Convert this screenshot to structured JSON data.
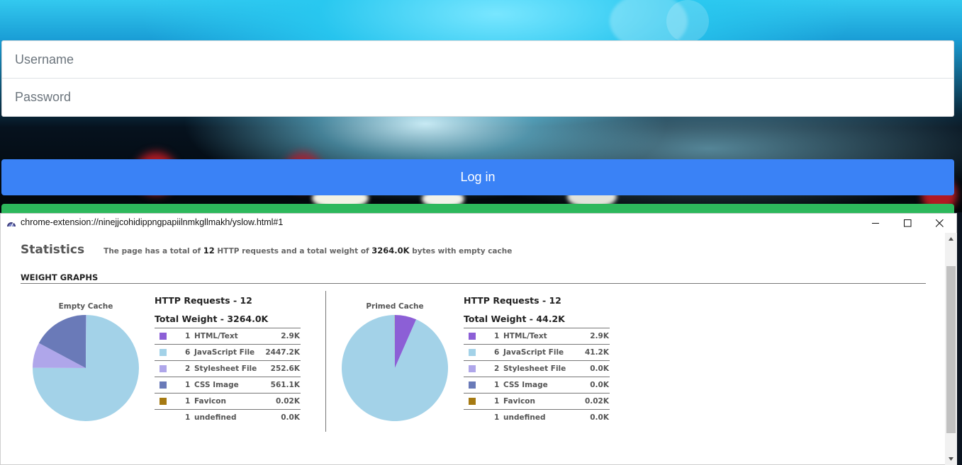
{
  "login": {
    "username_placeholder": "Username",
    "password_placeholder": "Password",
    "login_button": "Log in"
  },
  "popup": {
    "window_title": "chrome-extension://ninejjcohidippngpapiilnmkgllmakh/yslow.html#1",
    "statistics": {
      "title": "Statistics",
      "summary_prefix": "The page has a total of",
      "request_count": "12",
      "summary_middle": "HTTP requests and a total weight of",
      "total_weight": "3264.0K",
      "summary_suffix": "bytes with empty cache"
    },
    "section_title": "WEIGHT GRAPHS",
    "empty_cache": {
      "label": "Empty Cache",
      "http_requests": "HTTP Requests - 12",
      "total_weight": "Total Weight - 3264.0K",
      "rows": [
        {
          "count": "1",
          "type": "HTML/Text",
          "size": "2.9K",
          "color": "#8c5fd6"
        },
        {
          "count": "6",
          "type": "JavaScript File",
          "size": "2447.2K",
          "color": "#a3d2e8"
        },
        {
          "count": "2",
          "type": "Stylesheet File",
          "size": "252.6K",
          "color": "#afa6ea"
        },
        {
          "count": "1",
          "type": "CSS Image",
          "size": "561.1K",
          "color": "#6a7ab8"
        },
        {
          "count": "1",
          "type": "Favicon",
          "size": "0.02K",
          "color": "#a67a12"
        },
        {
          "count": "1",
          "type": "undefined",
          "size": "0.0K",
          "color": ""
        }
      ]
    },
    "primed_cache": {
      "label": "Primed Cache",
      "http_requests": "HTTP Requests - 12",
      "total_weight": "Total Weight - 44.2K",
      "rows": [
        {
          "count": "1",
          "type": "HTML/Text",
          "size": "2.9K",
          "color": "#8c5fd6"
        },
        {
          "count": "6",
          "type": "JavaScript File",
          "size": "41.2K",
          "color": "#a3d2e8"
        },
        {
          "count": "2",
          "type": "Stylesheet File",
          "size": "0.0K",
          "color": "#afa6ea"
        },
        {
          "count": "1",
          "type": "CSS Image",
          "size": "0.0K",
          "color": "#6a7ab8"
        },
        {
          "count": "1",
          "type": "Favicon",
          "size": "0.02K",
          "color": "#a67a12"
        },
        {
          "count": "1",
          "type": "undefined",
          "size": "0.0K",
          "color": ""
        }
      ]
    }
  },
  "chart_data": [
    {
      "type": "pie",
      "title": "Empty Cache",
      "categories": [
        "HTML/Text",
        "JavaScript File",
        "Stylesheet File",
        "CSS Image",
        "Favicon",
        "undefined"
      ],
      "values": [
        2.9,
        2447.2,
        252.6,
        561.1,
        0.02,
        0.0
      ],
      "colors": [
        "#8c5fd6",
        "#a3d2e8",
        "#afa6ea",
        "#6a7ab8",
        "#a67a12",
        "#cccccc"
      ]
    },
    {
      "type": "pie",
      "title": "Primed Cache",
      "categories": [
        "HTML/Text",
        "JavaScript File",
        "Stylesheet File",
        "CSS Image",
        "Favicon",
        "undefined"
      ],
      "values": [
        2.9,
        41.2,
        0.0,
        0.0,
        0.02,
        0.0
      ],
      "colors": [
        "#8c5fd6",
        "#a3d2e8",
        "#afa6ea",
        "#6a7ab8",
        "#a67a12",
        "#cccccc"
      ]
    }
  ]
}
